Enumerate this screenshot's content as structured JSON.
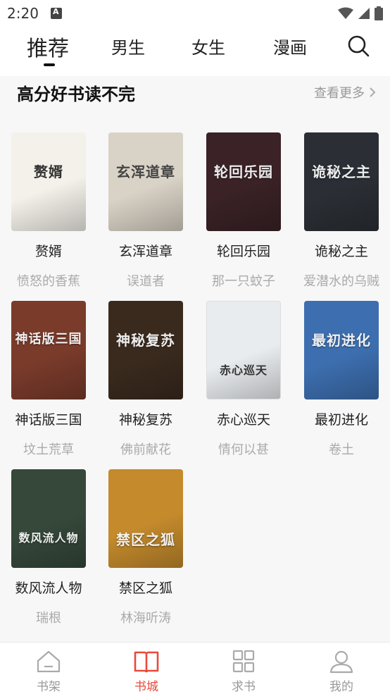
{
  "status_bar": {
    "time": "2:20"
  },
  "top_tabs": [
    {
      "label": "推荐",
      "active": true
    },
    {
      "label": "男生"
    },
    {
      "label": "女生"
    },
    {
      "label": "漫画"
    }
  ],
  "search_icon": "search-icon",
  "section": {
    "title": "高分好书读不完",
    "more": "查看更多"
  },
  "books": [
    {
      "title": "赘婿",
      "author": "愤怒的香蕉",
      "cover_text": "赘婿",
      "cover_color": "#f4f1ea"
    },
    {
      "title": "玄浑道章",
      "author": "误道者",
      "cover_text": "玄浑道章",
      "cover_color": "#d9d2c6"
    },
    {
      "title": "轮回乐园",
      "author": "那一只蚊子",
      "cover_text": "轮回乐园",
      "cover_color": "#3a2226"
    },
    {
      "title": "诡秘之主",
      "author": "爱潜水的乌贼",
      "cover_text": "诡秘之主",
      "cover_color": "#2b2f35"
    },
    {
      "title": "神话版三国",
      "author": "坟土荒草",
      "cover_text": "神话版三国",
      "cover_color": "#7a3b2b"
    },
    {
      "title": "神秘复苏",
      "author": "佛前献花",
      "cover_text": "神秘复苏",
      "cover_color": "#3a2a1e"
    },
    {
      "title": "赤心巡天",
      "author": "情何以甚",
      "cover_text": "赤心巡天",
      "cover_color": "#e9ecef"
    },
    {
      "title": "最初进化",
      "author": "卷土",
      "cover_text": "最初进化",
      "cover_color": "#3d6fb0"
    },
    {
      "title": "数风流人物",
      "author": "瑞根",
      "cover_text": "数风流人物",
      "cover_color": "#35483a"
    },
    {
      "title": "禁区之狐",
      "author": "林海听涛",
      "cover_text": "禁区之狐",
      "cover_color": "#c48a2c"
    }
  ],
  "bottom_nav": [
    {
      "label": "书架",
      "icon": "home-icon"
    },
    {
      "label": "书城",
      "icon": "book-icon",
      "active": true
    },
    {
      "label": "求书",
      "icon": "grid-icon"
    },
    {
      "label": "我的",
      "icon": "user-icon"
    }
  ]
}
